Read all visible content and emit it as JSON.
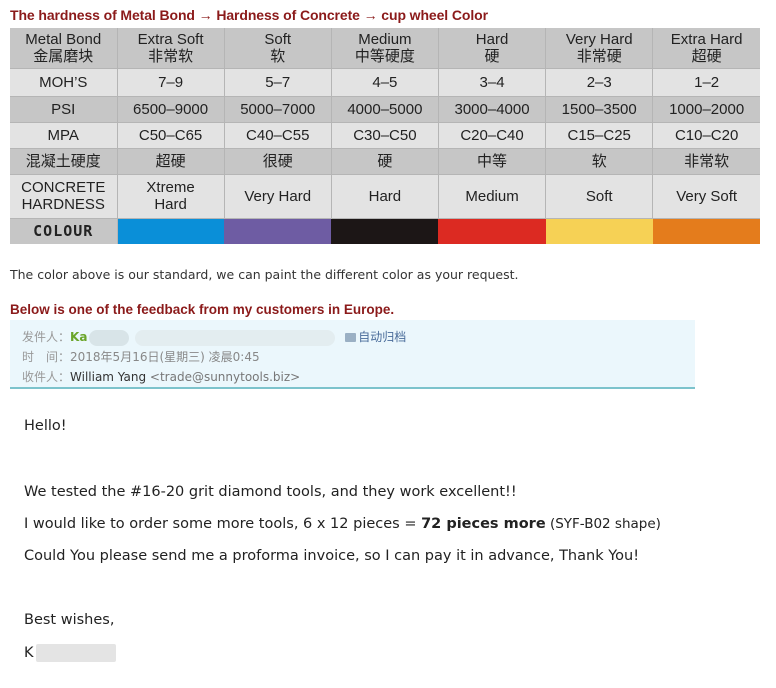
{
  "title": "The hardness of Metal Bond → Hardness of Concrete → cup wheel Color",
  "table": {
    "header": {
      "label": {
        "en": "Metal Bond",
        "cn": "金属磨块"
      },
      "columns": [
        {
          "en": "Extra Soft",
          "cn": "非常软"
        },
        {
          "en": "Soft",
          "cn": "软"
        },
        {
          "en": "Medium",
          "cn": "中等硬度"
        },
        {
          "en": "Hard",
          "cn": "硬"
        },
        {
          "en": "Very Hard",
          "cn": "非常硬"
        },
        {
          "en": "Extra Hard",
          "cn": "超硬"
        }
      ]
    },
    "rows": {
      "mohs": {
        "label": "MOH’S",
        "values": [
          "7–9",
          "5–7",
          "4–5",
          "3–4",
          "2–3",
          "1–2"
        ]
      },
      "psi": {
        "label": "PSI",
        "values": [
          "6500–9000",
          "5000–7000",
          "4000–5000",
          "3000–4000",
          "1500–3500",
          "1000–2000"
        ]
      },
      "mpa": {
        "label": "MPA",
        "values": [
          "C50–C65",
          "C40–C55",
          "C30–C50",
          "C20–C40",
          "C15–C25",
          "C10–C20"
        ]
      },
      "concrete_cn": {
        "label": "混凝土硬度",
        "values": [
          "超硬",
          "很硬",
          "硬",
          "中等",
          "软",
          "非常软"
        ]
      },
      "concrete_hardness": {
        "label_line1": "CONCRETE",
        "label_line2": "HARDNESS",
        "values": [
          "Xtreme Hard",
          "Very Hard",
          "Hard",
          "Medium",
          "Soft",
          "Very Soft"
        ]
      },
      "colour": {
        "label": "COLOUR",
        "swatches": [
          "#0a8fd8",
          "#6e5ca3",
          "#1c1616",
          "#dc2a22",
          "#f6d155",
          "#e47c1c"
        ]
      }
    }
  },
  "note": "The color above is our standard, we can paint the different color as your request.",
  "feedback_title": "Below is one of the feedback from my customers in Europe.",
  "mail": {
    "from_label": "发件人：",
    "from_name": "Ka",
    "archive_label": "自动归档",
    "time_label": "时　间：",
    "time_value": "2018年5月16日(星期三) 凌晨0:45",
    "to_label": "收件人：",
    "to_name": "William Yang",
    "to_addr": "<trade@sunnytools.biz>",
    "body": {
      "greeting": "Hello!",
      "line1": "We tested the #16-20 grit diamond tools, and they work excellent!!",
      "line2_pre": "I would like to order some more tools, 6 x 12 pieces = ",
      "line2_bold": "72 pieces more",
      "line2_post": " (SYF-B02 shape)",
      "line3": "Could You please send me a proforma invoice, so I can pay it in advance, Thank You!",
      "closing": "Best wishes,",
      "signature": "K"
    }
  }
}
